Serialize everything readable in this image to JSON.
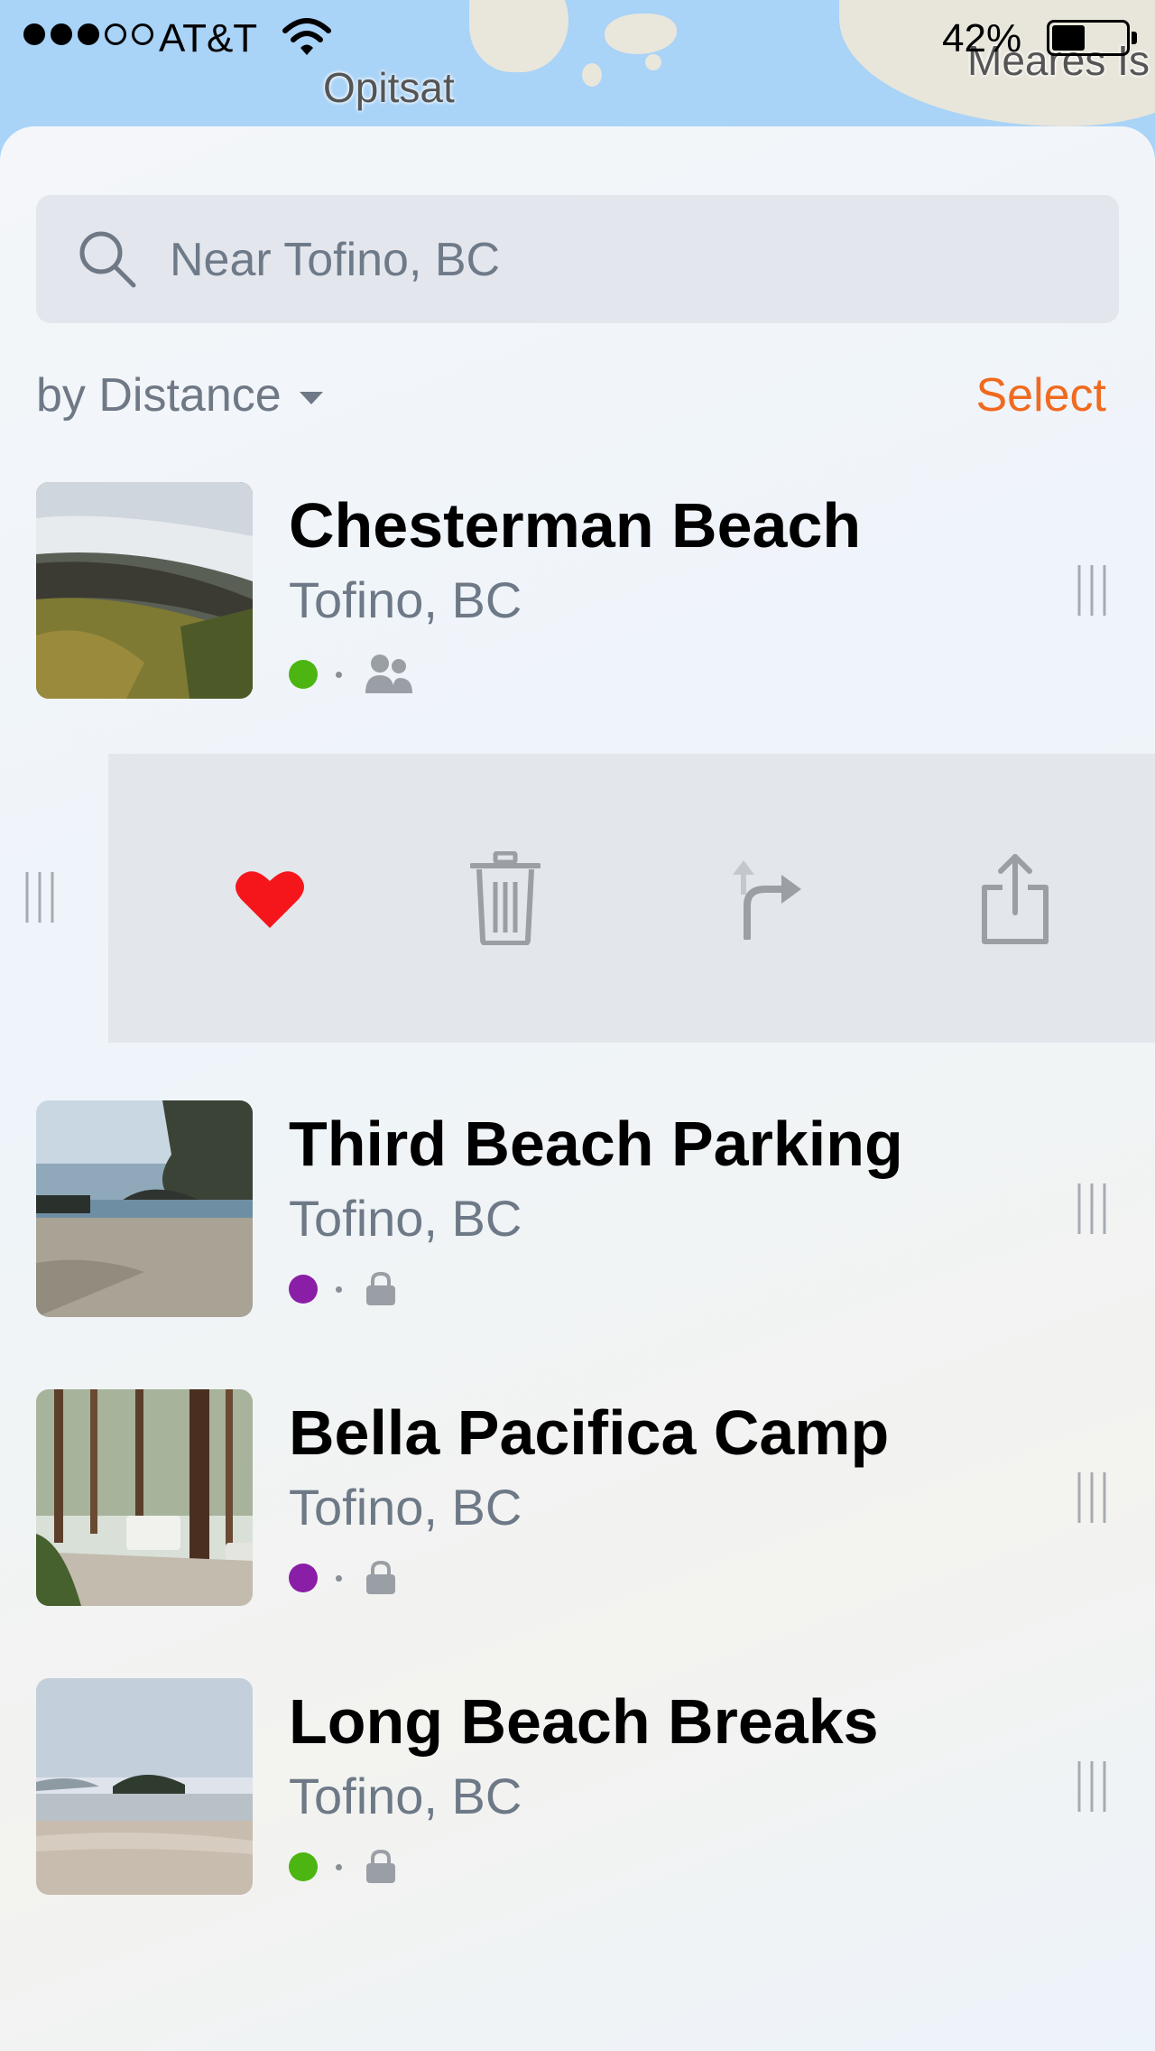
{
  "status_bar": {
    "carrier": "AT&T",
    "battery_percent": "42%",
    "signal_bars_filled": 3,
    "signal_bars_total": 5
  },
  "map": {
    "labels": [
      "Opitsat",
      "Meares Is"
    ]
  },
  "search": {
    "placeholder": "Near Tofino, BC",
    "icon": "search-icon"
  },
  "toolbar": {
    "sort_label": "by Distance",
    "select_label": "Select"
  },
  "colors": {
    "accent": "#f06a1f",
    "status_green": "#4cb512",
    "status_purple": "#8a1ea6",
    "favorite_red": "#f5161c",
    "icon_gray": "#9a9ea5"
  },
  "places": [
    {
      "name": "Chesterman Beach",
      "location": "Tofino, BC",
      "status_color": "#4cb512",
      "privacy_icon": "group-icon"
    },
    {
      "name": "Third Beach Parking",
      "location": "Tofino, BC",
      "status_color": "#8a1ea6",
      "privacy_icon": "lock-icon"
    },
    {
      "name": "Bella Pacifica Camp",
      "location": "Tofino, BC",
      "status_color": "#8a1ea6",
      "privacy_icon": "lock-icon"
    },
    {
      "name": "Long Beach Breaks",
      "location": "Tofino, BC",
      "status_color": "#4cb512",
      "privacy_icon": "lock-icon"
    }
  ],
  "swipe_actions": [
    {
      "icon": "heart-icon"
    },
    {
      "icon": "trash-icon"
    },
    {
      "icon": "directions-icon"
    },
    {
      "icon": "share-icon"
    }
  ]
}
